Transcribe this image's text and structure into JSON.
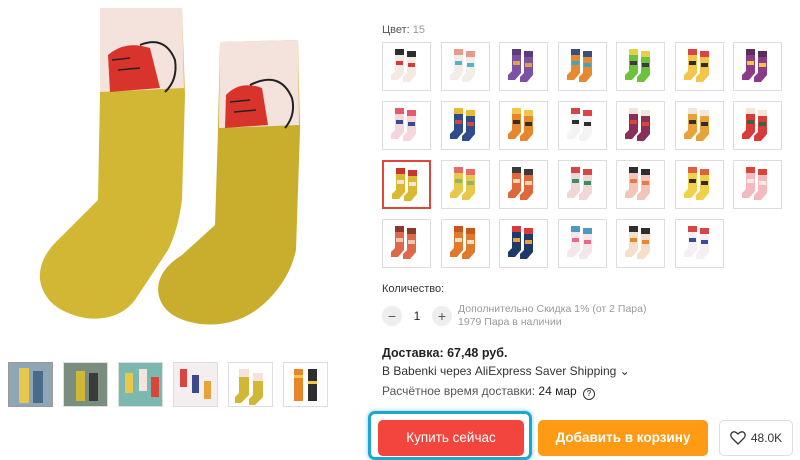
{
  "product": {
    "color_label": "Цвет:",
    "color_count": "15",
    "swatches": [
      {
        "icon": "sock-pair-icon",
        "c1": "#f5e9e4",
        "c2": "#d33a3a",
        "c3": "#2d2d2d"
      },
      {
        "icon": "sock-pair-icon",
        "c1": "#f4ece6",
        "c2": "#4bb7c4",
        "c3": "#e89a8a"
      },
      {
        "icon": "sock-pair-icon",
        "c1": "#7b52a3",
        "c2": "#e0a53a",
        "c3": "#5b3d7a"
      },
      {
        "icon": "sock-pair-icon",
        "c1": "#e78a2f",
        "c2": "#46a3b5",
        "c3": "#3b4f7a"
      },
      {
        "icon": "sock-pair-icon",
        "c1": "#6cc23a",
        "c2": "#3b3b3b",
        "c3": "#e5d04a"
      },
      {
        "icon": "sock-pair-icon",
        "c1": "#f2c64a",
        "c2": "#2e2e2e",
        "c3": "#d94545"
      },
      {
        "icon": "sock-pair-icon",
        "c1": "#8a3c8a",
        "c2": "#f0c93a",
        "c3": "#5a2d5a"
      },
      {
        "icon": "sock-pair-icon",
        "c1": "#f6d6dc",
        "c2": "#3b4a8a",
        "c3": "#e35a6a"
      },
      {
        "icon": "sock-pair-icon",
        "c1": "#2f4b8a",
        "c2": "#d9443b",
        "c3": "#e8b83a"
      },
      {
        "icon": "sock-pair-icon",
        "c1": "#e8862b",
        "c2": "#2e2e2e",
        "c3": "#f2c64a"
      },
      {
        "icon": "sock-pair-icon",
        "c1": "#f3f3f3",
        "c2": "#2e2e2e",
        "c3": "#d94545"
      },
      {
        "icon": "sock-pair-icon",
        "c1": "#8a2f5a",
        "c2": "#d9443b",
        "c3": "#f2e6d9"
      },
      {
        "icon": "sock-pair-icon",
        "c1": "#e8a23a",
        "c2": "#2e2e2e",
        "c3": "#f2e6d9"
      },
      {
        "icon": "sock-pair-icon",
        "c1": "#d93b3b",
        "c2": "#2d6a3a",
        "c3": "#f2e6d9"
      },
      {
        "icon": "sock-pair-icon",
        "c1": "#d9b832",
        "c2": "#f4e6dc",
        "c3": "#c9342e"
      },
      {
        "icon": "sock-pair-icon",
        "c1": "#e7c84a",
        "c2": "#8ab86a",
        "c3": "#e86a6a"
      },
      {
        "icon": "sock-pair-icon",
        "c1": "#e0673a",
        "c2": "#f4d6b0",
        "c3": "#3b3b3b"
      },
      {
        "icon": "sock-pair-icon",
        "c1": "#f2d6d6",
        "c2": "#3b8a6a",
        "c3": "#d94545"
      },
      {
        "icon": "sock-pair-icon",
        "c1": "#f2c6b6",
        "c2": "#e87a4a",
        "c3": "#2e2e2e"
      },
      {
        "icon": "sock-pair-icon",
        "c1": "#f2d04a",
        "c2": "#2e2e2e",
        "c3": "#e0603a"
      },
      {
        "icon": "sock-pair-icon",
        "c1": "#f5b8c0",
        "c2": "#f4ece6",
        "c3": "#d9443b"
      },
      {
        "icon": "sock-pair-icon",
        "c1": "#e0684a",
        "c2": "#f2c6b6",
        "c3": "#8a3a2a"
      },
      {
        "icon": "sock-pair-icon",
        "c1": "#e07a2a",
        "c2": "#f4e0c8",
        "c3": "#c8561e"
      },
      {
        "icon": "sock-pair-icon",
        "c1": "#1f3a6a",
        "c2": "#e8a23a",
        "c3": "#d93b3b"
      },
      {
        "icon": "sock-pair-icon",
        "c1": "#f4e6ea",
        "c2": "#e76a8a",
        "c3": "#4a9ac2"
      },
      {
        "icon": "sock-pair-icon",
        "c1": "#f4e0c8",
        "c2": "#e8862b",
        "c3": "#2e2e2e"
      },
      {
        "icon": "sock-pair-icon",
        "c1": "#f4f0f4",
        "c2": "#3b4a9a",
        "c3": "#d94545"
      }
    ],
    "selected_swatch_index": 14,
    "quantity": {
      "label": "Количество:",
      "minus": "−",
      "value": "1",
      "plus": "+",
      "discount": "Дополнительно Скидка 1% (от 2 Пара)",
      "stock": "1979 Пара в наличии"
    },
    "delivery": {
      "title": "Доставка: 67,48 руб.",
      "route": "В Babenki через AliExpress Saver Shipping",
      "route_chevron": "⌄",
      "time_label": "Расчётное время доставки:",
      "time_value": "24 мар",
      "help_icon": "?"
    },
    "buttons": {
      "buy_now": "Купить сейчас",
      "add_to_cart": "Добавить в корзину",
      "wishlist_count": "48.0K"
    }
  },
  "gallery": {
    "thumbnails": [
      {
        "name": "thumb-1",
        "bg": "#8fa6b6"
      },
      {
        "name": "thumb-2",
        "bg": "#7a8e80"
      },
      {
        "name": "thumb-3",
        "bg": "#7bb8b0"
      },
      {
        "name": "thumb-4",
        "bg": "#f4eeee"
      },
      {
        "name": "thumb-5",
        "bg": "#ffffff"
      },
      {
        "name": "thumb-6",
        "bg": "#ffffff"
      }
    ]
  },
  "colors": {
    "accent": "#f1453d",
    "cart": "#ff9a15",
    "highlight": "#1fa6cf",
    "sock_yellow": "#d2b735",
    "sock_cuff": "#f4e3dc"
  }
}
